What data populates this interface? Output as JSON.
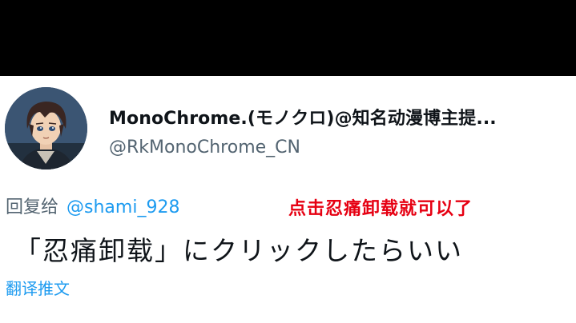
{
  "tweet": {
    "display_name": "MonoChrome.(モノクロ)@知名动漫博主提...",
    "handle": "@RkMonoChrome_CN",
    "reply_prefix": "回复给",
    "reply_mention": "@shami_928",
    "text": "「忍痛卸载」にクリックしたらいい",
    "translate_label": "翻译推文"
  },
  "overlay": {
    "caption": "点击忍痛卸载就可以了"
  },
  "icons": {
    "avatar": "anime-character-avatar"
  },
  "colors": {
    "background_letterbox": "#000000",
    "card_background": "#ffffff",
    "primary_text": "#0f1419",
    "secondary_text": "#536471",
    "link_blue": "#1d9bf0",
    "caption_red": "#e60012"
  }
}
